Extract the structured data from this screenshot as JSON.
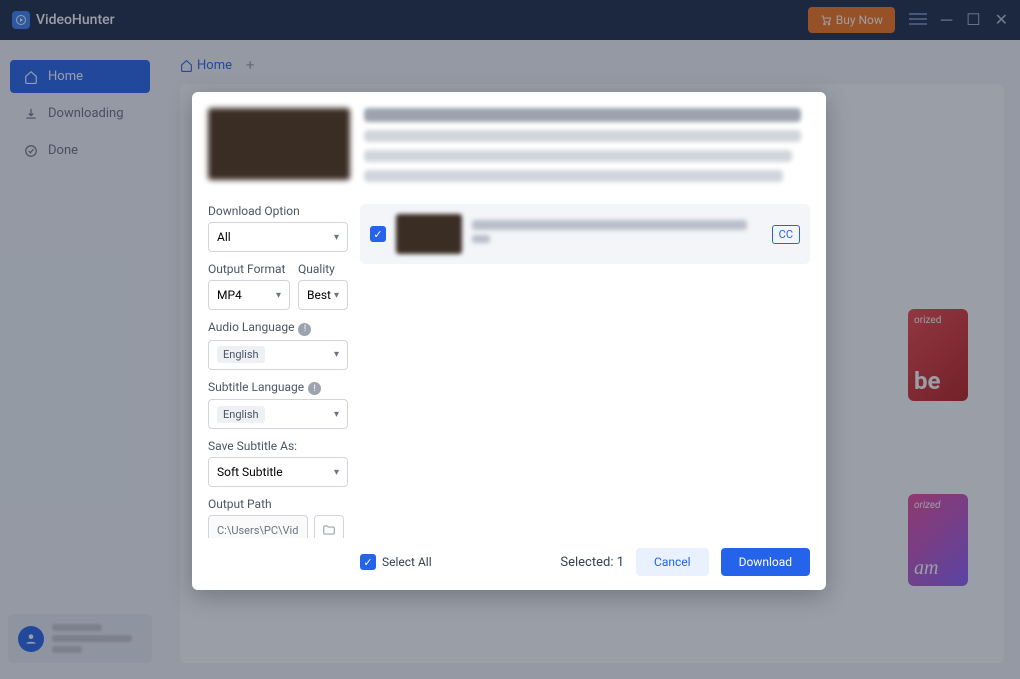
{
  "titlebar": {
    "app_name": "VideoHunter",
    "buy_label": "Buy Now"
  },
  "sidebar": {
    "items": [
      {
        "label": "Home"
      },
      {
        "label": "Downloading"
      },
      {
        "label": "Done"
      }
    ]
  },
  "tabs": {
    "home_label": "Home",
    "plus": "+"
  },
  "background_tiles": {
    "yt_badge": "orized",
    "yt_text": "be",
    "ig_badge": "orized",
    "ig_text": "am"
  },
  "modal": {
    "options": {
      "download_option_label": "Download Option",
      "download_option_value": "All",
      "output_format_label": "Output Format",
      "output_format_value": "MP4",
      "quality_label": "Quality",
      "quality_value": "Best",
      "audio_lang_label": "Audio Language",
      "audio_lang_value": "English",
      "subtitle_lang_label": "Subtitle Language",
      "subtitle_lang_value": "English",
      "save_subtitle_label": "Save Subtitle As:",
      "save_subtitle_value": "Soft Subtitle",
      "output_path_label": "Output Path",
      "output_path_value": "C:\\Users\\PC\\Vid"
    },
    "result": {
      "cc_label": "CC"
    },
    "footer": {
      "select_all_label": "Select All",
      "selected_label": "Selected:",
      "selected_count": "1",
      "cancel_label": "Cancel",
      "download_label": "Download"
    }
  }
}
